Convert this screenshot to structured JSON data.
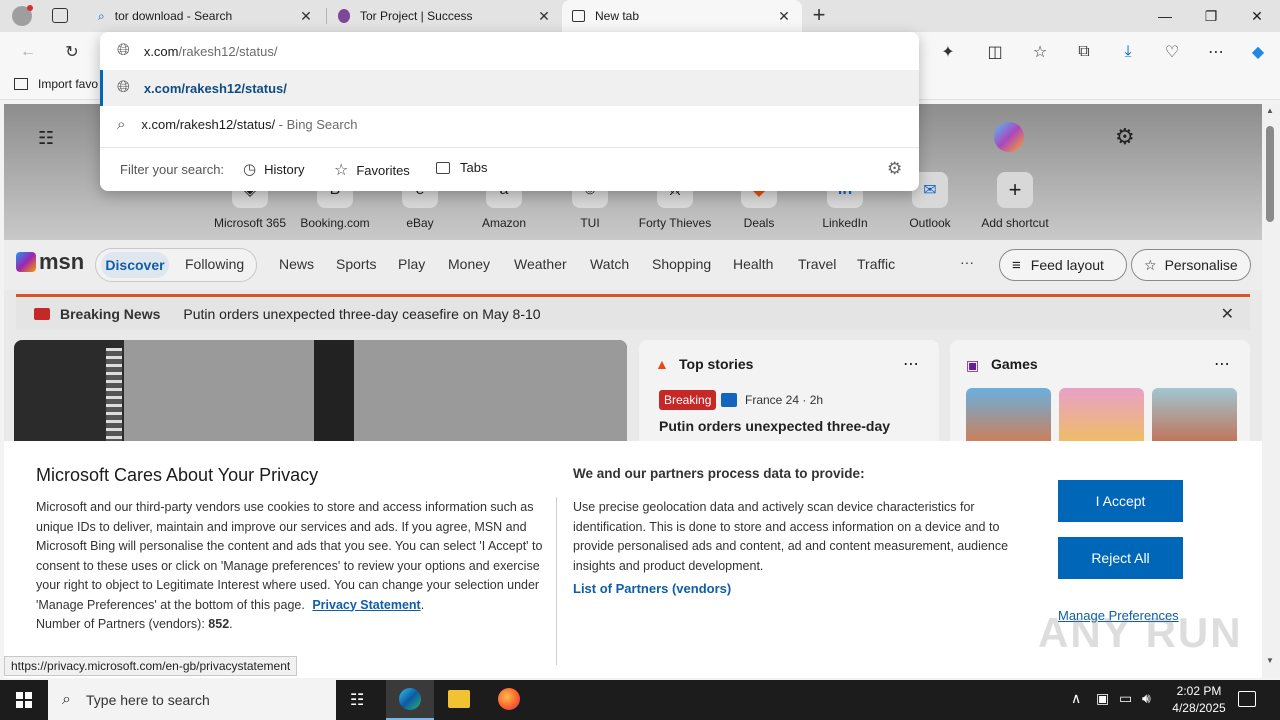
{
  "tabs": [
    {
      "title": "tor download - Search",
      "icon": "search-icon"
    },
    {
      "title": "Tor Project | Success",
      "icon": "tor-icon"
    },
    {
      "title": "New tab",
      "icon": "newtab-icon"
    }
  ],
  "address": {
    "value_host": "x.com",
    "value_path": "/rakesh12/status/"
  },
  "omnibox": {
    "suggestion_url": "x.com/rakesh12/status/",
    "search_query": "x.com/rakesh12/status/",
    "search_suffix": " - Bing Search",
    "filter_label": "Filter your search:",
    "filters": [
      "History",
      "Favorites",
      "Tabs"
    ]
  },
  "favorites_bar": {
    "import_label": "Import favo"
  },
  "shortcuts": [
    "Microsoft 365",
    "Booking.com",
    "eBay",
    "Amazon",
    "TUI",
    "Forty Thieves",
    "Deals",
    "LinkedIn",
    "Outlook",
    "Add shortcut"
  ],
  "msn": {
    "logo": "msn",
    "tabs": [
      "Discover",
      "Following"
    ],
    "nav": [
      "News",
      "Sports",
      "Play",
      "Money",
      "Weather",
      "Watch",
      "Shopping",
      "Health",
      "Travel",
      "Traffic"
    ],
    "more": "···",
    "feed_layout": "Feed layout",
    "personalise": "Personalise"
  },
  "breaking": {
    "label": "Breaking News",
    "headline": "Putin orders unexpected three-day ceasefire on May 8-10"
  },
  "top_stories": {
    "title": "Top stories",
    "badge": "Breaking",
    "source": "France 24 · 2h",
    "headline": "Putin orders unexpected three-day"
  },
  "games": {
    "title": "Games"
  },
  "privacy": {
    "title": "Microsoft Cares About Your Privacy",
    "body": "Microsoft and our third-party vendors use cookies to store and access information such as unique IDs to deliver, maintain and improve our services and ads. If you agree, MSN and Microsoft Bing will personalise the content and ads that you see. You can select 'I Accept' to consent to these uses or click on 'Manage preferences' to review your options and exercise your right to object to Legitimate Interest where used.  You can change your selection under 'Manage Preferences' at the bottom of this page.",
    "privacy_link": "Privacy Statement",
    "partners_label": "Number of Partners (vendors): ",
    "partners_count": "852",
    "purposes_title": "We and our partners process data to provide:",
    "purposes_body": "Use precise geolocation data and actively scan device characteristics for identification. This is done to store and access information on a device and to provide personalised ads and content, ad and content measurement, audience insights and product development.",
    "partners_link": "List of Partners (vendors)",
    "accept": "I Accept",
    "reject": "Reject All",
    "manage": "Manage Preferences"
  },
  "status_url": "https://privacy.microsoft.com/en-gb/privacystatement",
  "watermark": "ANY RUN",
  "taskbar": {
    "search_placeholder": "Type here to search",
    "time": "2:02 PM",
    "date": "4/28/2025"
  },
  "colors": {
    "accent": "#0067b8",
    "link": "#0f5ea8",
    "breaking": "#c62828"
  }
}
